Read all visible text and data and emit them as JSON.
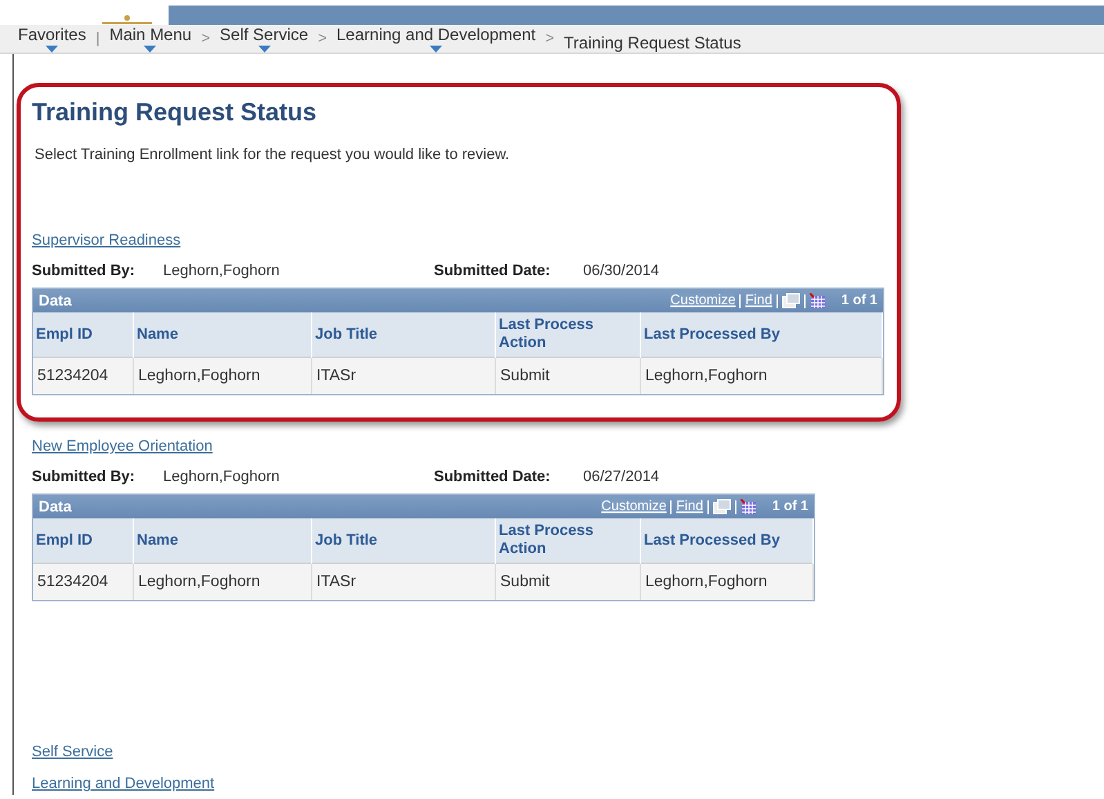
{
  "breadcrumbs": [
    {
      "label": "Favorites",
      "dropdown": true,
      "separator": "|"
    },
    {
      "label": "Main Menu",
      "dropdown": true,
      "separator": ">"
    },
    {
      "label": "Self Service",
      "dropdown": true,
      "separator": ">"
    },
    {
      "label": "Learning and Development",
      "dropdown": true,
      "separator": ">"
    },
    {
      "label": "Training Request Status",
      "dropdown": false
    }
  ],
  "framed_section": {
    "title": "Training Request Status",
    "instructions": "Select Training Enrollment link for the request you would like to review.",
    "requests": [
      {
        "link": "Supervisor Readiness",
        "submitted_by_label": "Submitted By:",
        "submitted_by": "Leghorn,Foghorn",
        "submitted_date_label": "Submitted Date:",
        "submitted_date": "06/30/2014",
        "grid": {
          "title": "Data",
          "customize": "Customize",
          "find": "Find",
          "count": "1 of 1",
          "columns": [
            "Empl ID",
            "Name",
            "Job Title",
            "Last Process Action",
            "Last Processed By"
          ],
          "rows": [
            [
              "51234204",
              "Leghorn,Foghorn",
              "ITASr",
              "Submit",
              "Leghorn,Foghorn"
            ]
          ]
        }
      }
    ]
  },
  "requests": [
    {
      "link": "New Employee Orientation",
      "submitted_by_label": "Submitted By:",
      "submitted_by": "Leghorn,Foghorn",
      "submitted_date_label": "Submitted Date:",
      "submitted_date": "06/27/2014",
      "grid": {
        "title": "Data",
        "customize": "Customize",
        "find": "Find",
        "count": "1 of 1",
        "columns": [
          "Empl ID",
          "Name",
          "Job Title",
          "Last Process Action",
          "Last Processed By"
        ],
        "rows": [
          [
            "51234204",
            "Leghorn,Foghorn",
            "ITASr",
            "Submit",
            "Leghorn,Foghorn"
          ]
        ]
      }
    }
  ],
  "footer_links": [
    "Self Service",
    "Learning and Development"
  ]
}
